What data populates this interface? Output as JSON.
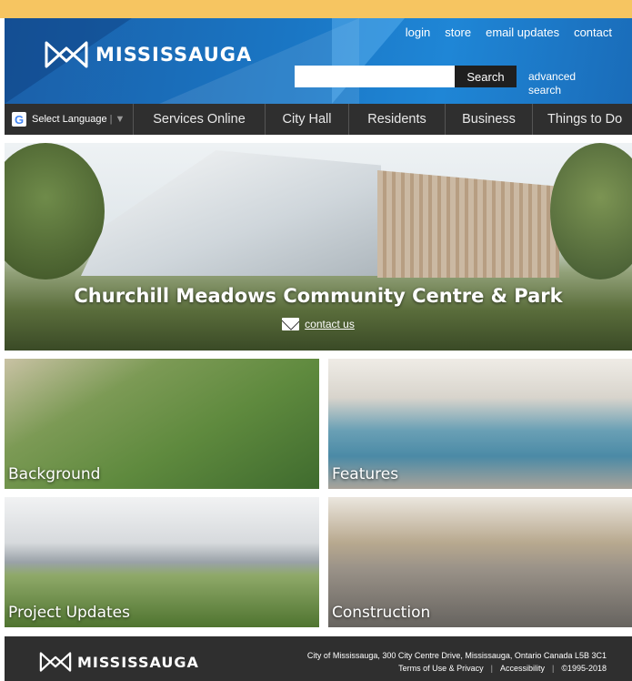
{
  "header": {
    "logo_text": "MISSISSAUGA",
    "links": [
      "login",
      "store",
      "email updates",
      "contact"
    ],
    "search_placeholder": "",
    "search_button": "Search",
    "advanced_search": "advanced search"
  },
  "nav": {
    "language_label": "Select Language",
    "language_sep": "| ▼",
    "items": [
      "Services Online",
      "City Hall",
      "Residents",
      "Business",
      "Things to Do"
    ]
  },
  "hero": {
    "title": "Churchill Meadows Community Centre & Park",
    "contact_link": "contact us"
  },
  "tiles": [
    "Background",
    "Features",
    "Project Updates",
    "Construction"
  ],
  "footer": {
    "logo_text": "MISSISSAUGA",
    "address": "City of Mississauga, 300 City Centre Drive, Mississauga, Ontario Canada L5B 3C1",
    "links": [
      "Terms of Use & Privacy",
      "Accessibility",
      "©1995-2018"
    ]
  },
  "colors": {
    "top_bar": "#f6c561",
    "header_blue": "#1a76c4",
    "nav_bg": "#2f2f2f",
    "footer_bg": "#2f2f2f"
  }
}
